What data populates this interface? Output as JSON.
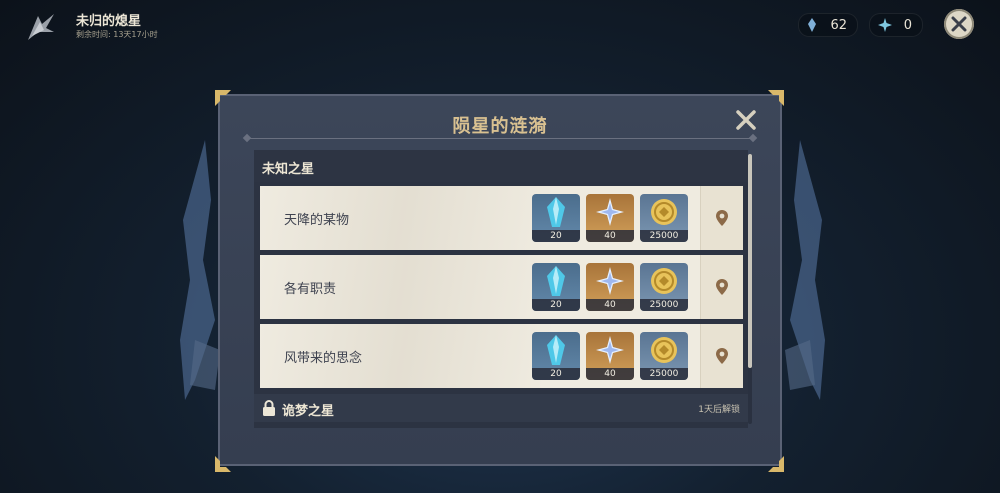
{
  "event": {
    "title": "未归的熄星",
    "time_remaining": "剩余时间: 13天17小时"
  },
  "currencies": [
    {
      "icon": "feather-token-icon",
      "value": "62"
    },
    {
      "icon": "star-shard-icon",
      "value": "0"
    }
  ],
  "modal": {
    "title": "陨星的涟漪",
    "sections": [
      {
        "title": "未知之星",
        "quests": [
          {
            "name": "天降的某物",
            "rewards": [
              {
                "icon": "crystal-icon",
                "count": "20"
              },
              {
                "icon": "primogem-icon",
                "count": "40"
              },
              {
                "icon": "mora-coin-icon",
                "count": "25000"
              }
            ]
          },
          {
            "name": "各有职责",
            "rewards": [
              {
                "icon": "crystal-icon",
                "count": "20"
              },
              {
                "icon": "primogem-icon",
                "count": "40"
              },
              {
                "icon": "mora-coin-icon",
                "count": "25000"
              }
            ]
          },
          {
            "name": "风带来的思念",
            "rewards": [
              {
                "icon": "crystal-icon",
                "count": "20"
              },
              {
                "icon": "primogem-icon",
                "count": "40"
              },
              {
                "icon": "mora-coin-icon",
                "count": "25000"
              }
            ]
          }
        ]
      },
      {
        "title": "诡梦之星",
        "locked": true,
        "unlock_note": "1天后解锁"
      }
    ]
  },
  "colors": {
    "accent_gold": "#d9c191",
    "panel": "#3c4659",
    "row_bg": "#efebe0"
  }
}
